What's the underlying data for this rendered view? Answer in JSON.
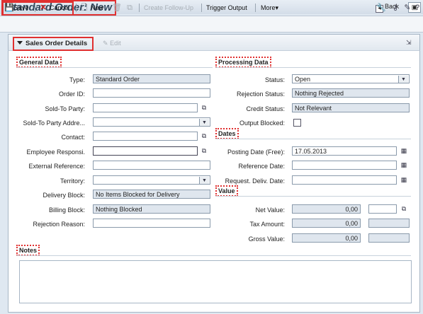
{
  "window": {
    "title": "Standard Order: New",
    "back_label": "Back",
    "back_arrow": "▾",
    "pin_icon": "▣"
  },
  "toolbar": {
    "save_label": "Save",
    "cancel_label": "Cancel",
    "new_label": "New",
    "create_follow_up_label": "Create Follow-Up",
    "trigger_output_label": "Trigger Output",
    "more_label": "More",
    "more_arrow": "▾"
  },
  "panel": {
    "title": "Sales Order Details",
    "edit_label": "Edit"
  },
  "general": {
    "heading": "General Data",
    "type_label": "Type:",
    "type_value": "Standard Order",
    "order_id_label": "Order ID:",
    "sold_to_label": "Sold-To Party:",
    "sold_to_addr_label": "Sold-To Party Addre...",
    "contact_label": "Contact:",
    "employee_label": "Employee Responsi.",
    "ext_ref_label": "External Reference:",
    "territory_label": "Territory:",
    "delivery_block_label": "Delivery Block:",
    "delivery_block_value": "No Items Blocked for Delivery",
    "billing_block_label": "Billing Block:",
    "billing_block_value": "Nothing Blocked",
    "rejection_reason_label": "Rejection Reason:"
  },
  "processing": {
    "heading": "Processing Data",
    "status_label": "Status:",
    "status_value": "Open",
    "rejection_status_label": "Rejection Status:",
    "rejection_status_value": "Nothing Rejected",
    "credit_status_label": "Credit Status:",
    "credit_status_value": "Not Relevant",
    "output_blocked_label": "Output Blocked:"
  },
  "dates": {
    "heading": "Dates",
    "posting_label": "Posting Date (Free):",
    "posting_value": "17.05.2013",
    "reference_label": "Reference Date:",
    "request_deliv_label": "Request. Deliv. Date:"
  },
  "value": {
    "heading": "Value",
    "net_label": "Net Value:",
    "net_value": "0,00",
    "tax_label": "Tax Amount:",
    "tax_value": "0,00",
    "gross_label": "Gross Value:",
    "gross_value": "0,00"
  },
  "notes": {
    "heading": "Notes"
  },
  "icons": {
    "dropdown": "▼",
    "value_help": "⧉",
    "calendar": "▦"
  },
  "colors": {
    "highlight": "#e03030",
    "readonly_field": "#dfe6ee",
    "background": "#dfe8f1"
  }
}
